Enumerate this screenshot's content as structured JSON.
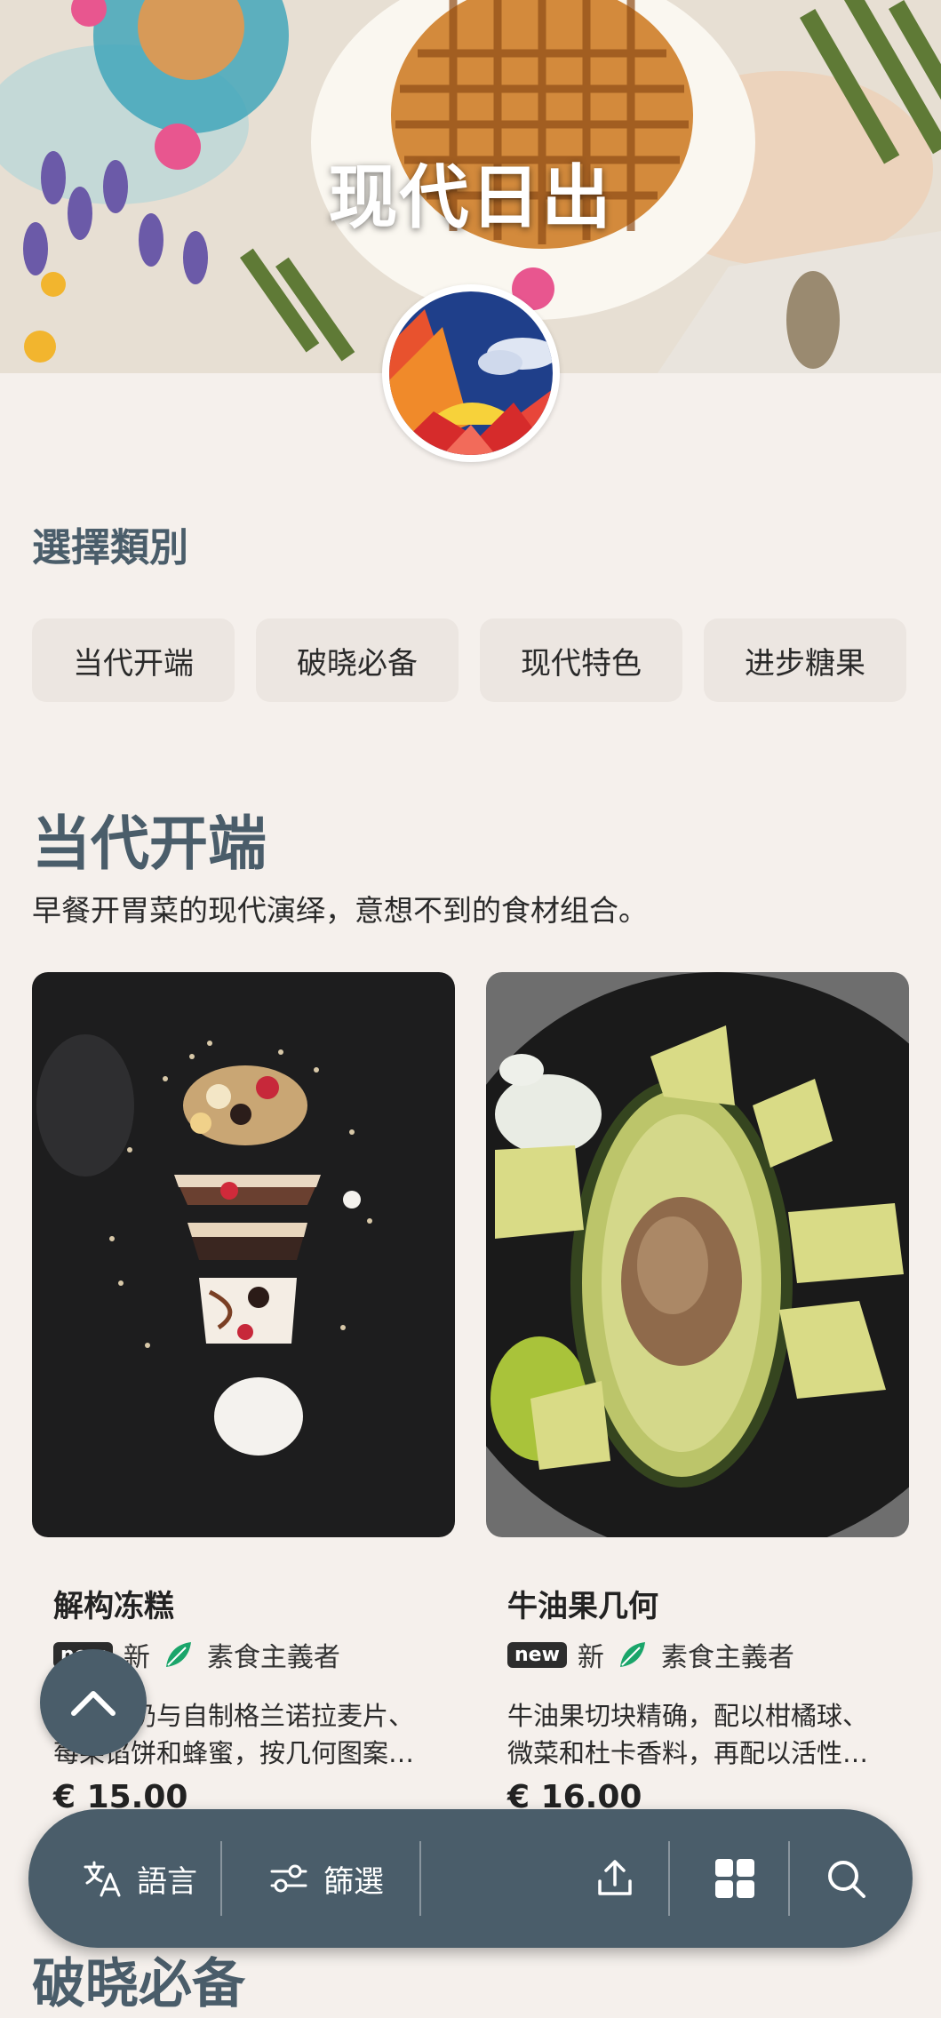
{
  "header": {
    "title": "现代日出"
  },
  "categories": {
    "heading": "選擇類別",
    "items": [
      "当代开端",
      "破晓必备",
      "现代特色",
      "进步糖果"
    ]
  },
  "section": {
    "title": "当代开端",
    "description": "早餐开胃菜的现代演绎，意想不到的食材组合。"
  },
  "items": [
    {
      "name": "解构冻糕",
      "badge": "new",
      "badge_text": "新",
      "diet": "素食主義者",
      "description_line1": "希腊酸奶与自制格兰诺拉麦片、",
      "description_line2": "莓果馅饼和蜂蜜，按几何图案…",
      "price": "€ 15.00"
    },
    {
      "name": "牛油果几何",
      "badge": "new",
      "badge_text": "新",
      "diet": "素食主義者",
      "description_line1": "牛油果切块精确，配以柑橘球、",
      "description_line2": "微菜和杜卡香料，再配以活性…",
      "price": "€ 16.00"
    }
  ],
  "next_section": {
    "title": "破晓必备"
  },
  "bottom_bar": {
    "language_label": "語言",
    "filter_label": "篩選"
  },
  "icons": {
    "language": "translate-icon",
    "filter": "filter-icon",
    "share": "share-icon",
    "grid": "grid-icon",
    "search": "search-icon",
    "scroll_top": "chevron-up-icon",
    "vegan": "vegan-leaf-icon"
  },
  "colors": {
    "background": "#f5f0ec",
    "accent": "#4a5d6a",
    "chip": "#ece6e1",
    "vegan_green": "#1aa56a"
  }
}
